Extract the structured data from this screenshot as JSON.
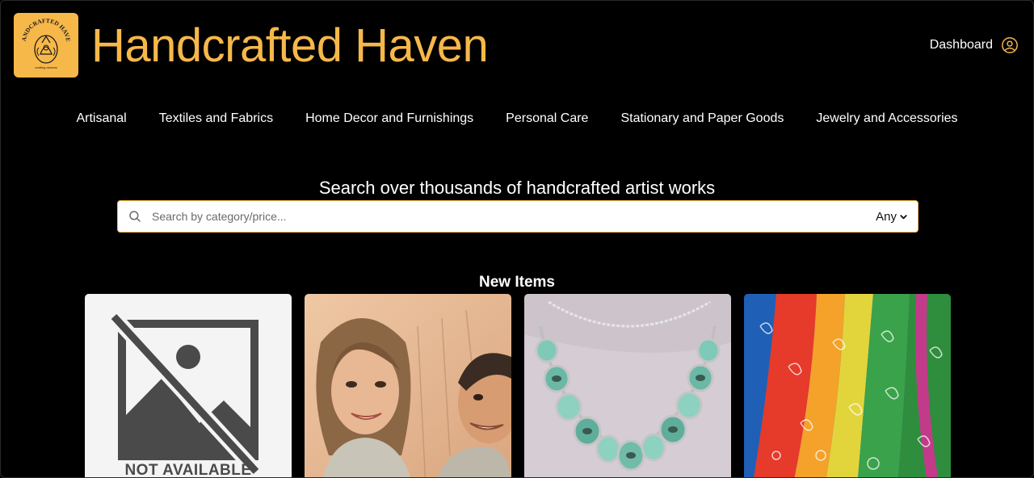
{
  "header": {
    "brand_name": "Handcrafted Haven",
    "logo_text": "HANDCRAFTED HAVEN",
    "logo_tagline": "crafting dreams",
    "dashboard_label": "Dashboard",
    "accent_color": "#f7b84a"
  },
  "nav": {
    "items": [
      {
        "label": "Artisanal"
      },
      {
        "label": "Textiles and Fabrics"
      },
      {
        "label": "Home Decor and Furnishings"
      },
      {
        "label": "Personal Care"
      },
      {
        "label": "Stationary and Paper Goods"
      },
      {
        "label": "Jewelry and Accessories"
      }
    ]
  },
  "search": {
    "heading": "Search over thousands of handcrafted artist works",
    "placeholder": "Search by category/price...",
    "value": "",
    "filter_selected": "Any"
  },
  "new_items": {
    "title": "New Items",
    "cards": [
      {
        "image": "image-not-available",
        "caption": "NOT AVAILABLE"
      },
      {
        "image": "portrait-sketch-couple"
      },
      {
        "image": "turquoise-geode-necklace"
      },
      {
        "image": "colorful-paisley-scarves"
      }
    ]
  },
  "icons": {
    "user": "user-circle-icon",
    "search": "search-icon",
    "chevron": "chevron-down-icon"
  }
}
